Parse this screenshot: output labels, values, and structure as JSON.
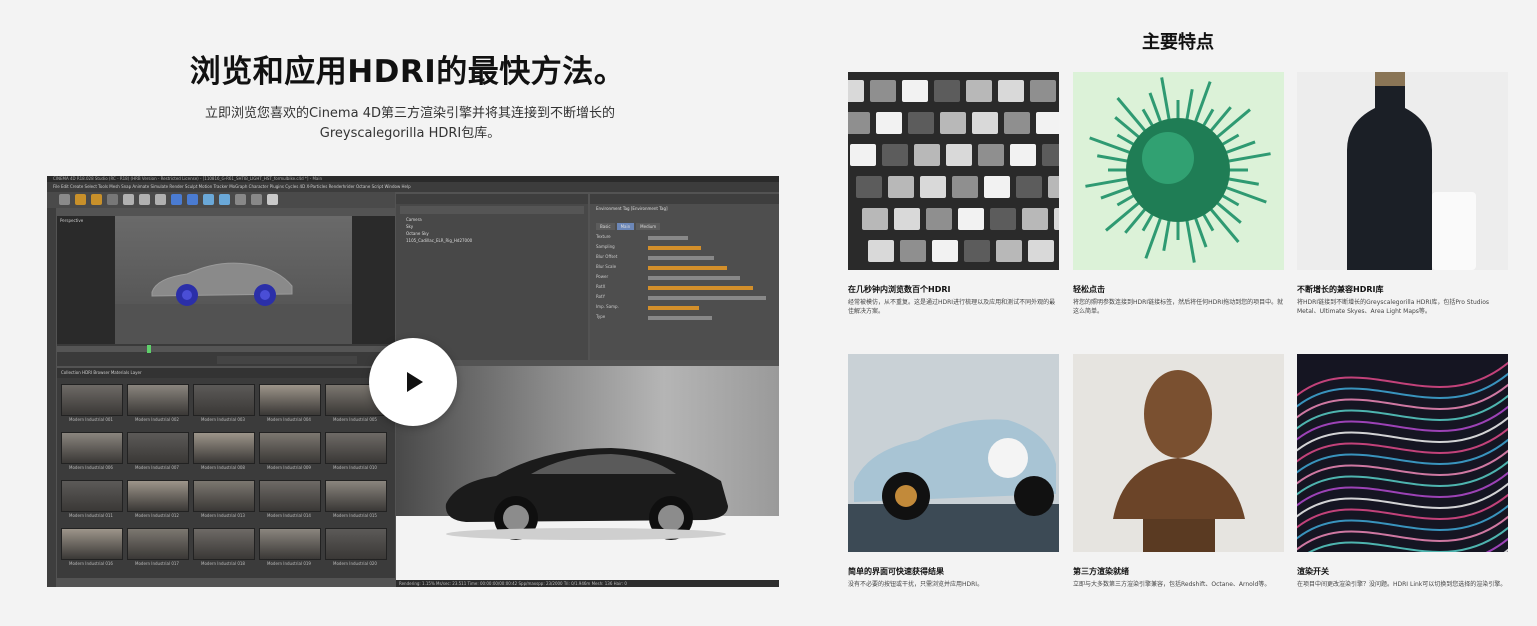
{
  "hero": {
    "title": "浏览和应用HDRI的最快方法。",
    "description_line1": "立即浏览您喜欢的Cinema 4D第三方渲染引擎并将其连接到不断增长的",
    "description_line2": "Greyscalegorilla HDRI包库。"
  },
  "video": {
    "play_icon": "play-icon",
    "window_title": "CINEMA 4D R18.028 Studio (RC - R18) (HRB Version - Restricted License) - [110816_G-R61_SHTIB_LIGHT_HST_formulbike.c4d *] - Main",
    "menu_items": [
      "File",
      "Edit",
      "Create",
      "Select",
      "Tools",
      "Mesh",
      "Snap",
      "Animate",
      "Simulate",
      "Render",
      "Sculpt",
      "Motion Tracker",
      "MoGraph",
      "Character",
      "Plugins",
      "Cycles 4D",
      "X-Particles",
      "Renderhrider",
      "Octane",
      "Script",
      "Window",
      "Help"
    ],
    "viewport_label": "Perspective",
    "objects": [
      "Camera",
      "Sky",
      "Octane Sky",
      "1105_Cadillac_ELR_Rig_Hd27000"
    ],
    "attributes": {
      "tag_title": "Environment Tag [Environment Tag]",
      "tabs": [
        "Basic",
        "Main",
        "Medium"
      ],
      "rows": [
        "Texture",
        "Sampling",
        "Blur Offset",
        "Blur Scale",
        "Power",
        "RotX",
        "RotY",
        "Imp. Samp.",
        "Type"
      ]
    },
    "hdri_browser": {
      "toolbar": [
        "Collection",
        "HDRI Browser",
        "Materials",
        "Layer"
      ],
      "thumbs": [
        "Modern Industrial 001",
        "Modern Industrial 002",
        "Modern Industrial 003",
        "Modern Industrial 004",
        "Modern Industrial 005",
        "Modern Industrial 006",
        "Modern Industrial 007",
        "Modern Industrial 008",
        "Modern Industrial 009",
        "Modern Industrial 010",
        "Modern Industrial 011",
        "Modern Industrial 012",
        "Modern Industrial 013",
        "Modern Industrial 014",
        "Modern Industrial 015",
        "Modern Industrial 016",
        "Modern Industrial 017",
        "Modern Industrial 018",
        "Modern Industrial 019",
        "Modern Industrial 020"
      ]
    },
    "status": "Rendering: 1.15%   Ms/sec: 23.511   Time: 00:00:00/00:00:42   Spp/maxspp: 23/2000   Tri: 0/1.946m   Mesh: 136   Hair: 0"
  },
  "features": {
    "title": "主要特点",
    "items": [
      {
        "name": "在几秒钟内浏览数百个HDRI",
        "desc": "经常被模仿，从不重复。这是通过HDRI进行梳理以及应用和测试不同外观的最佳解决方案。",
        "icon": "hdri-thumbnails-image"
      },
      {
        "name": "轻松点击",
        "desc": "将您的照明参数连接到HDRI链接标签，然后将任何HDRI拖动到您的项目中。就这么简单。",
        "icon": "glass-virus-sculpture-image"
      },
      {
        "name": "不断增长的兼容HDRI库",
        "desc": "将HDRI链接到不断增长的Greyscalegorilla HDRI库，包括Pro Studios Metal、Ultimate Skyes、Area Light Maps等。",
        "icon": "coffee-bottle-image"
      },
      {
        "name": "简单的界面可快速获得结果",
        "desc": "没有不必要的按钮或干扰，只需浏览并应用HDRI。",
        "icon": "race-car-image"
      },
      {
        "name": "第三方渲染就绪",
        "desc": "立即与大多数第三方渲染引擎兼容，包括Redshift、Octane、Arnold等。",
        "icon": "bronze-bust-image"
      },
      {
        "name": "渲染开关",
        "desc": "在项目中间更改渲染引擎？没问题。HDRI Link可以切换到您选择的渲染引擎。",
        "icon": "abstract-light-streaks-image"
      }
    ]
  },
  "colors": {
    "background": "#f3f3f3",
    "ui_dark": "#535353",
    "accent_green": "#2d9a6a"
  }
}
